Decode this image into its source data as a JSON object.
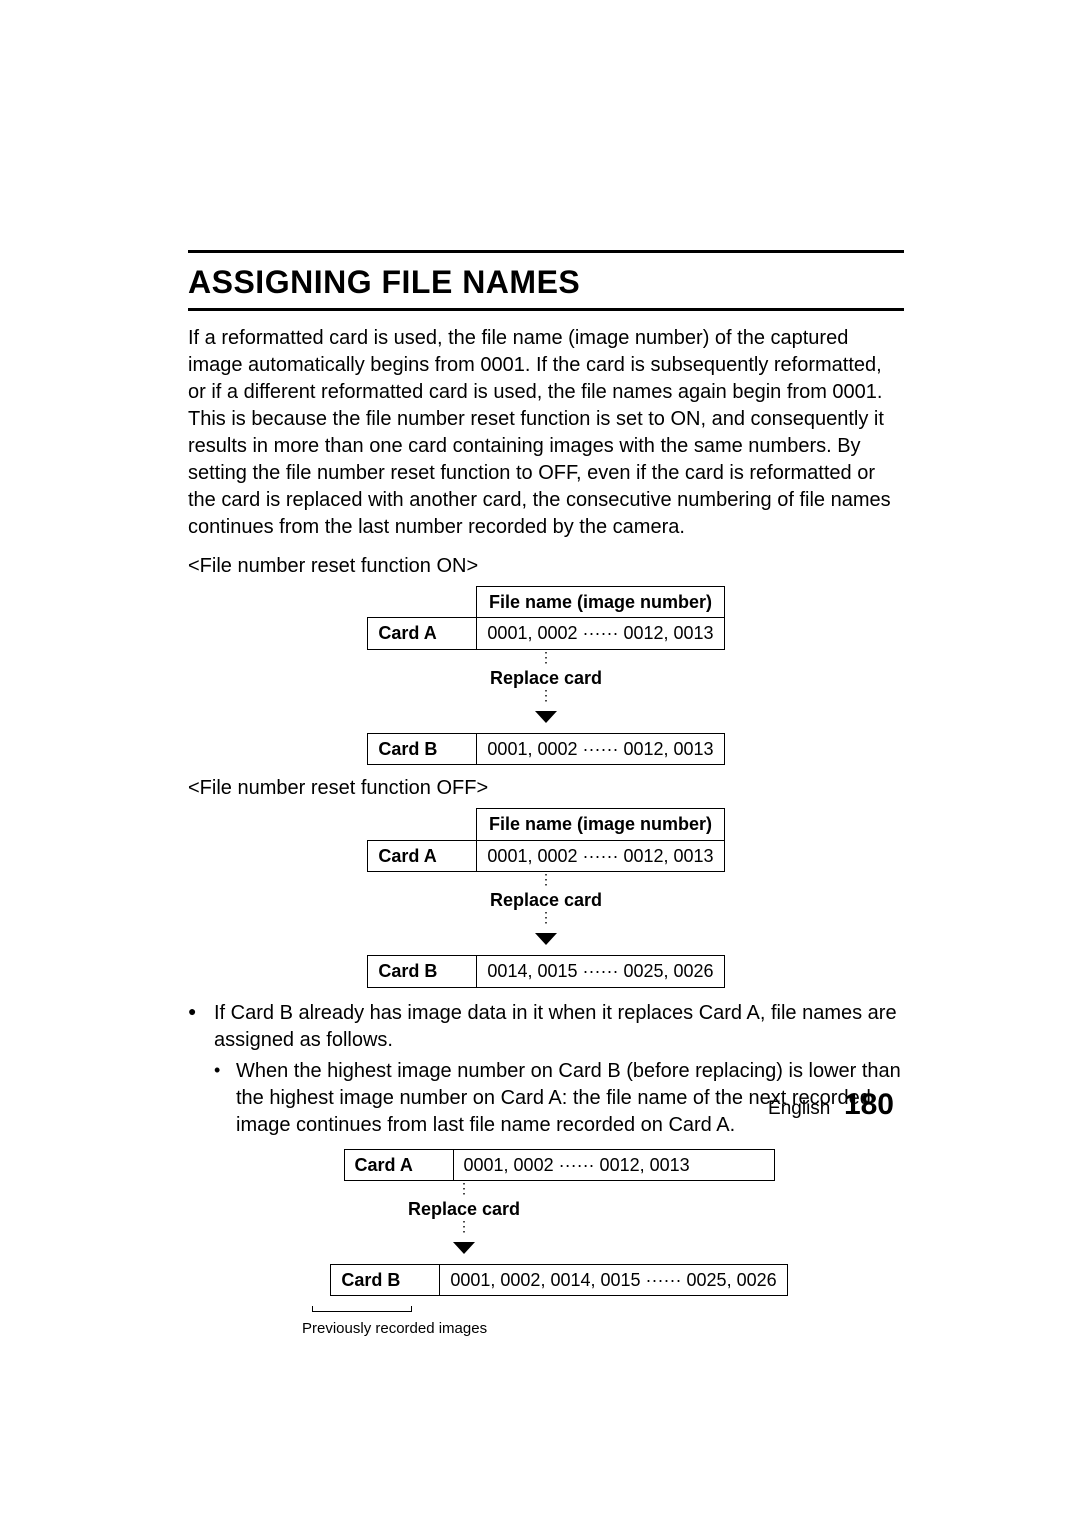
{
  "title": "ASSIGNING FILE NAMES",
  "intro": "If a reformatted card is used, the file name (image number) of the captured image automatically begins from 0001. If the card is subsequently reformatted, or if a different reformatted card is used, the file names again begin from 0001. This is because the file number reset function is set to ON, and consequently it results in more than one card containing images with the same numbers. By setting the file number reset function to OFF, even if the card is reformatted or the card is replaced with another card, the consecutive numbering of file names continues from the last number recorded by the camera.",
  "section_on_label": "<File number reset function ON>",
  "section_off_label": "<File number reset function OFF>",
  "table_header": "File name (image number)",
  "card_a_label": "Card A",
  "card_b_label": "Card B",
  "replace_label": "Replace card",
  "table_on": {
    "a": "0001, 0002 ······ 0012, 0013",
    "b": "0001, 0002 ······ 0012, 0013"
  },
  "table_off": {
    "a": "0001, 0002 ······ 0012, 0013",
    "b": "0014, 0015 ······ 0025, 0026"
  },
  "bullet_main": "If Card B already has image data in it when it replaces Card A, file names are assigned as follows.",
  "bullet_sub": "When the highest image number on Card B (before replacing) is lower than the highest image number on Card A: the file name of the next recorded image continues from last file name recorded on Card A.",
  "table_ex": {
    "a": "0001, 0002 ······ 0012, 0013",
    "b_prev": "0001, 0002,",
    "b_new": "0014, 0015 ······ 0025, 0026"
  },
  "prev_recorded_label": "Previously recorded images",
  "footer": {
    "language": "English",
    "page": "180"
  }
}
